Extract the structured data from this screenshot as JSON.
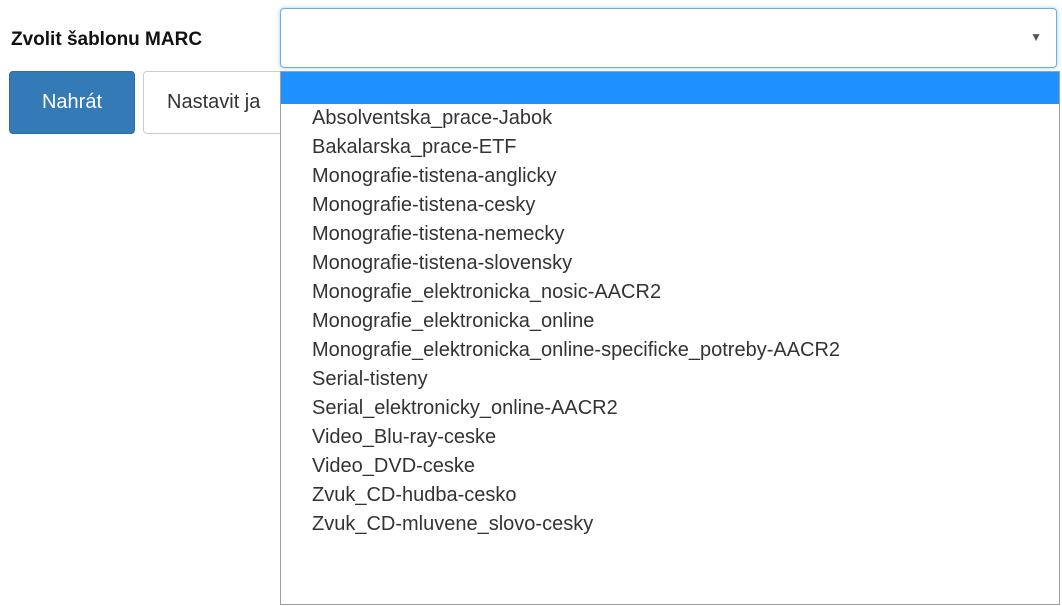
{
  "form": {
    "label": "Zvolit šablonu MARC",
    "select_value": "",
    "upload_button": "Nahrát",
    "settings_button": "Nastavit ja"
  },
  "dropdown": {
    "options": [
      "",
      "Absolventska_prace-Jabok",
      "Bakalarska_prace-ETF",
      "Monografie-tistena-anglicky",
      "Monografie-tistena-cesky",
      "Monografie-tistena-nemecky",
      "Monografie-tistena-slovensky",
      "Monografie_elektronicka_nosic-AACR2",
      "Monografie_elektronicka_online",
      "Monografie_elektronicka_online-specificke_potreby-AACR2",
      "Serial-tisteny",
      "Serial_elektronicky_online-AACR2",
      "Video_Blu-ray-ceske",
      "Video_DVD-ceske",
      "Zvuk_CD-hudba-cesko",
      "Zvuk_CD-mluvene_slovo-cesky"
    ],
    "highlighted_index": 0
  },
  "colors": {
    "highlight": "#1e90ff",
    "primary_button": "#337ab7",
    "focus_border": "#66afe9"
  },
  "icons": {
    "select_arrow": "triangle-down-icon"
  }
}
